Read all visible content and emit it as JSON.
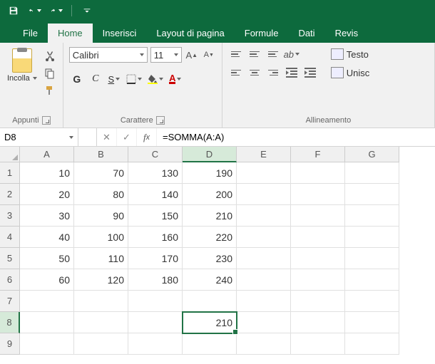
{
  "qat": {
    "save": "save",
    "undo": "undo",
    "redo": "redo"
  },
  "tabs": {
    "file": "File",
    "home": "Home",
    "insert": "Inserisci",
    "layout": "Layout di pagina",
    "formulas": "Formule",
    "data": "Dati",
    "review": "Revis"
  },
  "ribbon": {
    "clipboard": {
      "paste": "Incolla",
      "group": "Appunti"
    },
    "font": {
      "name": "Calibri",
      "size": "11",
      "bold": "G",
      "italic": "C",
      "underline": "S",
      "group": "Carattere"
    },
    "alignment": {
      "wrap": "Testo",
      "merge": "Unisc",
      "group": "Allineamento"
    }
  },
  "namebox": "D8",
  "formula": "=SOMMA(A:A)",
  "columns": [
    "A",
    "B",
    "C",
    "D",
    "E",
    "F",
    "G"
  ],
  "rows": [
    "1",
    "2",
    "3",
    "4",
    "5",
    "6",
    "7",
    "8",
    "9"
  ],
  "active": {
    "col": 3,
    "row": 7
  },
  "cells": [
    [
      "10",
      "70",
      "130",
      "190",
      "",
      "",
      ""
    ],
    [
      "20",
      "80",
      "140",
      "200",
      "",
      "",
      ""
    ],
    [
      "30",
      "90",
      "150",
      "210",
      "",
      "",
      ""
    ],
    [
      "40",
      "100",
      "160",
      "220",
      "",
      "",
      ""
    ],
    [
      "50",
      "110",
      "170",
      "230",
      "",
      "",
      ""
    ],
    [
      "60",
      "120",
      "180",
      "240",
      "",
      "",
      ""
    ],
    [
      "",
      "",
      "",
      "",
      "",
      "",
      ""
    ],
    [
      "",
      "",
      "",
      "210",
      "",
      "",
      ""
    ],
    [
      "",
      "",
      "",
      "",
      "",
      "",
      ""
    ]
  ]
}
